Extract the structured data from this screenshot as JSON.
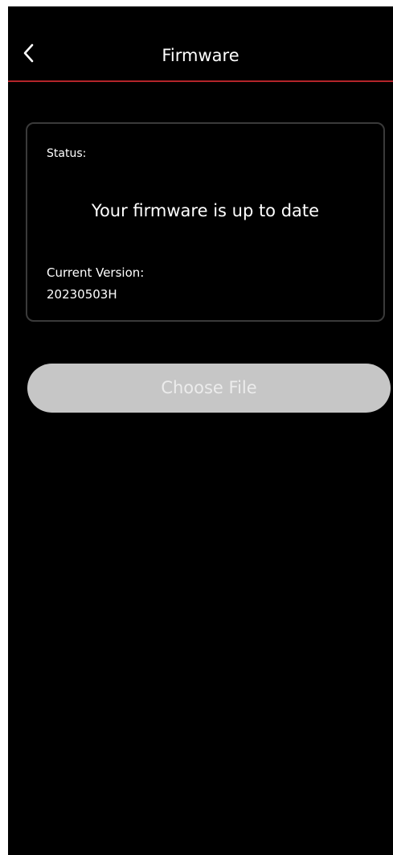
{
  "header": {
    "back_icon": "chevron-left-icon",
    "title": "Firmware"
  },
  "status_card": {
    "status_label": "Status:",
    "status_message": "Your firmware is up to date",
    "version_label": "Current Version:",
    "version_value": "20230503H"
  },
  "actions": {
    "choose_file_label": "Choose File"
  },
  "colors": {
    "background": "#000000",
    "header_divider": "#b3242a",
    "card_border": "#3a3a3a",
    "button_background": "#c6c6c6",
    "button_text": "#ececec",
    "text": "#ffffff"
  }
}
